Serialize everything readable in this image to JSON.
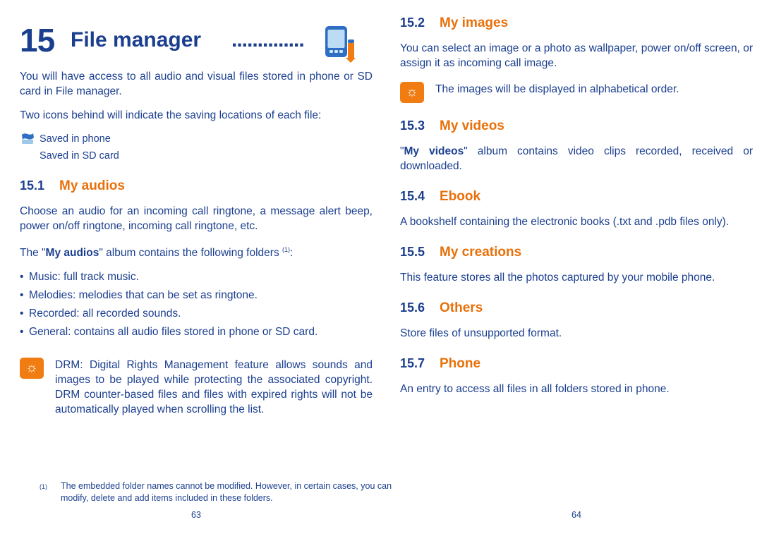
{
  "chapter": {
    "number": "15",
    "title": "File manager",
    "dots": "..............",
    "icon": "mobile-phone-icon"
  },
  "left_column": {
    "intro": "You will have access to all audio and visual files stored in phone or SD card in File manager.",
    "icons_note": "Two icons behind will indicate the saving locations of each file:",
    "locations": [
      {
        "icon": "phone-memory-icon",
        "label": "Saved in phone"
      },
      {
        "icon": "sd-card-icon",
        "label": "Saved in SD card"
      }
    ],
    "section_audios": {
      "number": "15.1",
      "title": "My audios",
      "p1": "Choose an audio for an incoming call ringtone, a message alert beep, power on/off ringtone, incoming call ringtone, etc.",
      "p2_prefix": "The \"",
      "p2_bold": "My audios",
      "p2_suffix": "\" album contains the following folders ",
      "p2_footnote_mark": "(1)",
      "p2_end": ":",
      "bullets": [
        "Music: full track music.",
        "Melodies: melodies that can be set as ringtone.",
        "Recorded: all recorded sounds.",
        "General: contains all audio files stored in phone or SD card."
      ],
      "tip_icon": "tip-bulb-icon",
      "tip": "DRM: Digital Rights Management feature allows sounds and images to be played while protecting the associated copyright. DRM counter-based files and files with expired rights will not be automatically played when scrolling the list."
    },
    "footnote": {
      "mark": "(1)",
      "text": "The embedded folder names cannot be modified. However, in certain cases, you can modify, delete and add items included in these folders."
    },
    "page_number": "63"
  },
  "right_column": {
    "section_images": {
      "number": "15.2",
      "title": "My images",
      "p1": "You can select an image or a photo as wallpaper, power on/off screen, or assign it as incoming call image.",
      "tip_icon": "tip-bulb-icon",
      "tip": "The images will be displayed in alphabetical order."
    },
    "section_videos": {
      "number": "15.3",
      "title": "My videos",
      "p1_prefix": "\"",
      "p1_bold": "My videos",
      "p1_suffix": "\" album contains video clips recorded, received or downloaded."
    },
    "section_ebook": {
      "number": "15.4",
      "title": "Ebook",
      "p1": "A bookshelf containing the electronic books (.txt and .pdb files only)."
    },
    "section_creations": {
      "number": "15.5",
      "title": "My creations",
      "p1": "This feature stores all the photos captured by your mobile phone."
    },
    "section_others": {
      "number": "15.6",
      "title": "Others",
      "p1": "Store files of unsupported format."
    },
    "section_phone": {
      "number": "15.7",
      "title": "Phone",
      "p1": "An entry to access all files in all folders stored in phone."
    },
    "page_number": "64"
  },
  "colors": {
    "blue": "#1b3f8f",
    "orange": "#e8700a",
    "tip_bg": "#f07c12"
  }
}
